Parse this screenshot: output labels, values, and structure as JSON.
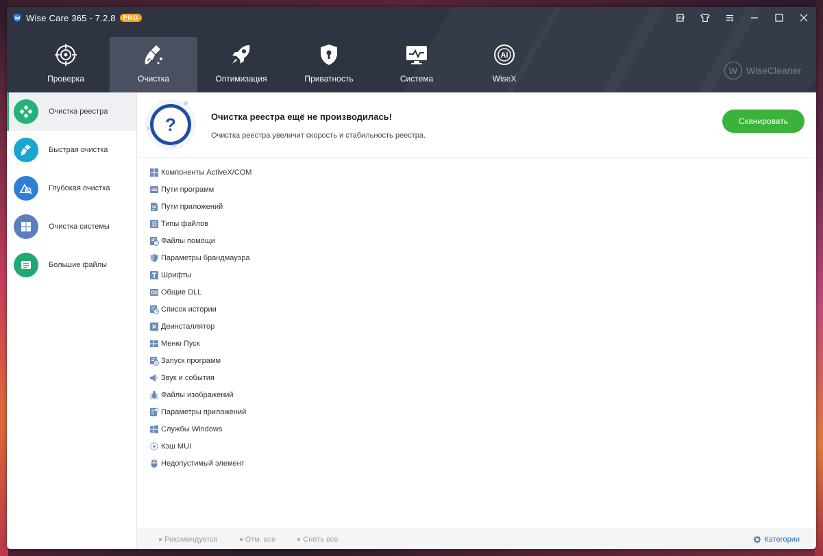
{
  "app": {
    "title": "Wise Care 365 - 7.2.8",
    "badge": "PRO"
  },
  "nav": [
    {
      "label": "Проверка",
      "icon": "target-icon"
    },
    {
      "label": "Очистка",
      "icon": "broom-icon",
      "active": true
    },
    {
      "label": "Оптимизация",
      "icon": "rocket-icon"
    },
    {
      "label": "Приватность",
      "icon": "shield-lock-icon"
    },
    {
      "label": "Система",
      "icon": "monitor-icon"
    },
    {
      "label": "WiseX",
      "icon": "ai-icon"
    }
  ],
  "brand": {
    "letter": "W",
    "name": "WiseCleaner"
  },
  "sidebar": [
    {
      "label": "Очистка реестра",
      "icon": "registry-icon",
      "color": "#26b07a",
      "active": true
    },
    {
      "label": "Быстрая очистка",
      "icon": "quick-clean-icon",
      "color": "#1aa7cf"
    },
    {
      "label": "Глубокая очистка",
      "icon": "deep-clean-icon",
      "color": "#2d7fd8"
    },
    {
      "label": "Очистка системы",
      "icon": "windows-icon",
      "color": "#5a7ec0"
    },
    {
      "label": "Большие файлы",
      "icon": "large-files-icon",
      "color": "#20a873"
    }
  ],
  "header": {
    "title": "Очистка реестра ещё не производилась!",
    "description": "Очистка реестра увеличит скорость и стабильность реестра.",
    "scan_label": "Сканировать",
    "question_mark": "?"
  },
  "items": [
    {
      "label": "Компоненты ActiveX/COM",
      "icon": "grid-icon"
    },
    {
      "label": "Пути программ",
      "icon": "window-list-icon"
    },
    {
      "label": "Пути приложений",
      "icon": "document-icon"
    },
    {
      "label": "Типы файлов",
      "icon": "list-icon"
    },
    {
      "label": "Файлы помощи",
      "icon": "help-file-icon"
    },
    {
      "label": "Параметры брандмауэра",
      "icon": "firewall-icon"
    },
    {
      "label": "Шрифты",
      "icon": "font-icon"
    },
    {
      "label": "Общие DLL",
      "icon": "dll-icon"
    },
    {
      "label": "Список истории",
      "icon": "history-icon"
    },
    {
      "label": "Деинсталлятор",
      "icon": "uninstall-icon"
    },
    {
      "label": "Меню Пуск",
      "icon": "start-menu-icon"
    },
    {
      "label": "Запуск программ",
      "icon": "startup-icon"
    },
    {
      "label": "Звук и события",
      "icon": "sound-icon"
    },
    {
      "label": "Файлы изображений",
      "icon": "bug-icon"
    },
    {
      "label": "Параметры приложений",
      "icon": "app-settings-icon"
    },
    {
      "label": "Службы Windows",
      "icon": "windows-services-icon"
    },
    {
      "label": "Кэш MUI",
      "icon": "mui-cache-icon"
    },
    {
      "label": "Недопустимый элемент",
      "icon": "mouse-icon"
    }
  ],
  "footer": {
    "recommended": "Рекомендуется",
    "select_all": "Отм. все",
    "deselect_all": "Снять все",
    "categories": "Категории"
  },
  "colors": {
    "topbar": "#2e3442",
    "accent_green": "#3bb33b",
    "icon_blue": "#1e4ea3",
    "link_blue": "#2a6fbf"
  }
}
